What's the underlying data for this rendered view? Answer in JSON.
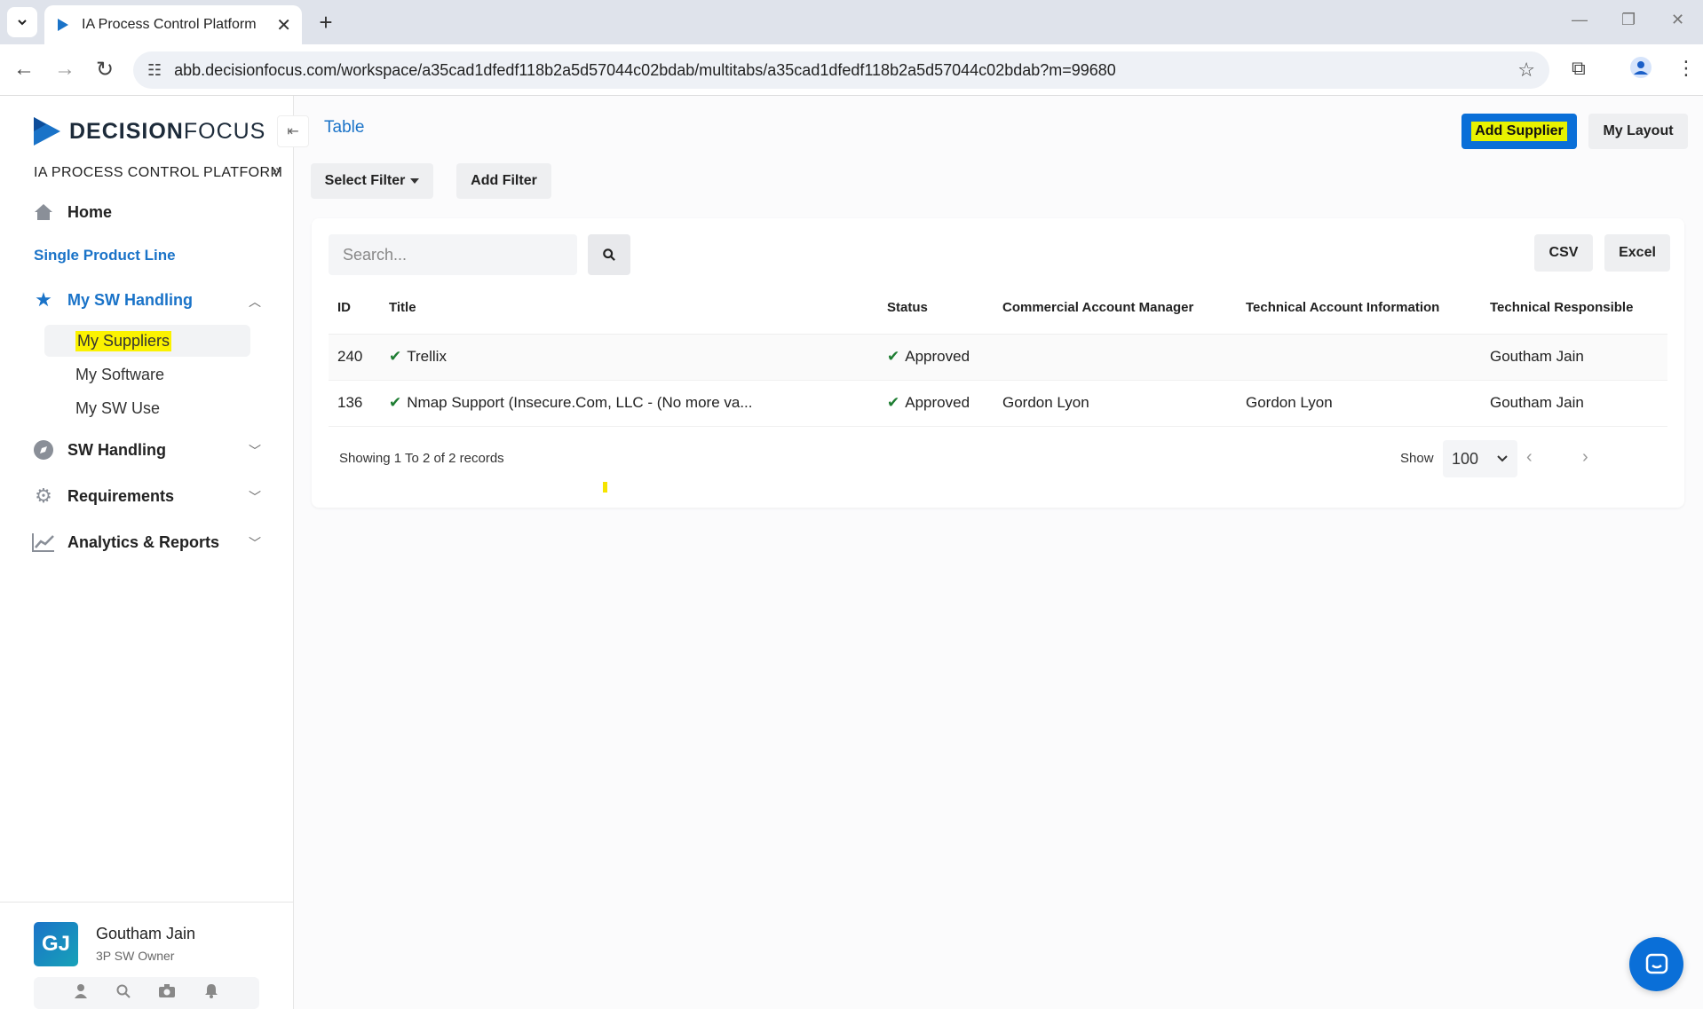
{
  "browser": {
    "tab_title": "IA Process Control Platform",
    "url": "abb.decisionfocus.com/workspace/a35cad1dfedf118b2a5d57044c02bdab/multitabs/a35cad1dfedf118b2a5d57044c02bdab?m=99680"
  },
  "sidebar": {
    "logo_bold": "DECISION",
    "logo_light": "FOCUS",
    "platform_name": "IA PROCESS CONTROL PLATFORM",
    "home": "Home",
    "section": "Single Product Line",
    "my_sw_handling": "My SW Handling",
    "sub_items": [
      "My Suppliers",
      "My Software",
      "My SW Use"
    ],
    "sw_handling": "SW Handling",
    "requirements": "Requirements",
    "analytics": "Analytics & Reports",
    "user": {
      "initials": "GJ",
      "name": "Goutham Jain",
      "role": "3P SW Owner"
    }
  },
  "main": {
    "title": "Table",
    "add_supplier": "Add Supplier",
    "my_layout": "My Layout",
    "select_filter": "Select Filter",
    "add_filter": "Add Filter",
    "search_placeholder": "Search...",
    "csv": "CSV",
    "excel": "Excel",
    "columns": [
      "ID",
      "Title",
      "Status",
      "Commercial Account Manager",
      "Technical Account Information",
      "Technical Responsible"
    ],
    "rows": [
      {
        "id": "240",
        "title": "Trellix",
        "status": "Approved",
        "cam": "",
        "tai": "",
        "tr": "Goutham Jain"
      },
      {
        "id": "136",
        "title": "Nmap Support (Insecure.Com, LLC - (No more va...",
        "status": "Approved",
        "cam": "Gordon Lyon",
        "tai": "Gordon Lyon",
        "tr": "Goutham Jain"
      }
    ],
    "records_info": "Showing 1 To 2 of 2 records",
    "show_label": "Show",
    "page_size": "100"
  },
  "colors": {
    "accent": "#1a73c8",
    "primary_button": "#0a6fd8",
    "highlight": "#fbf200",
    "approved": "#1e7d32"
  }
}
